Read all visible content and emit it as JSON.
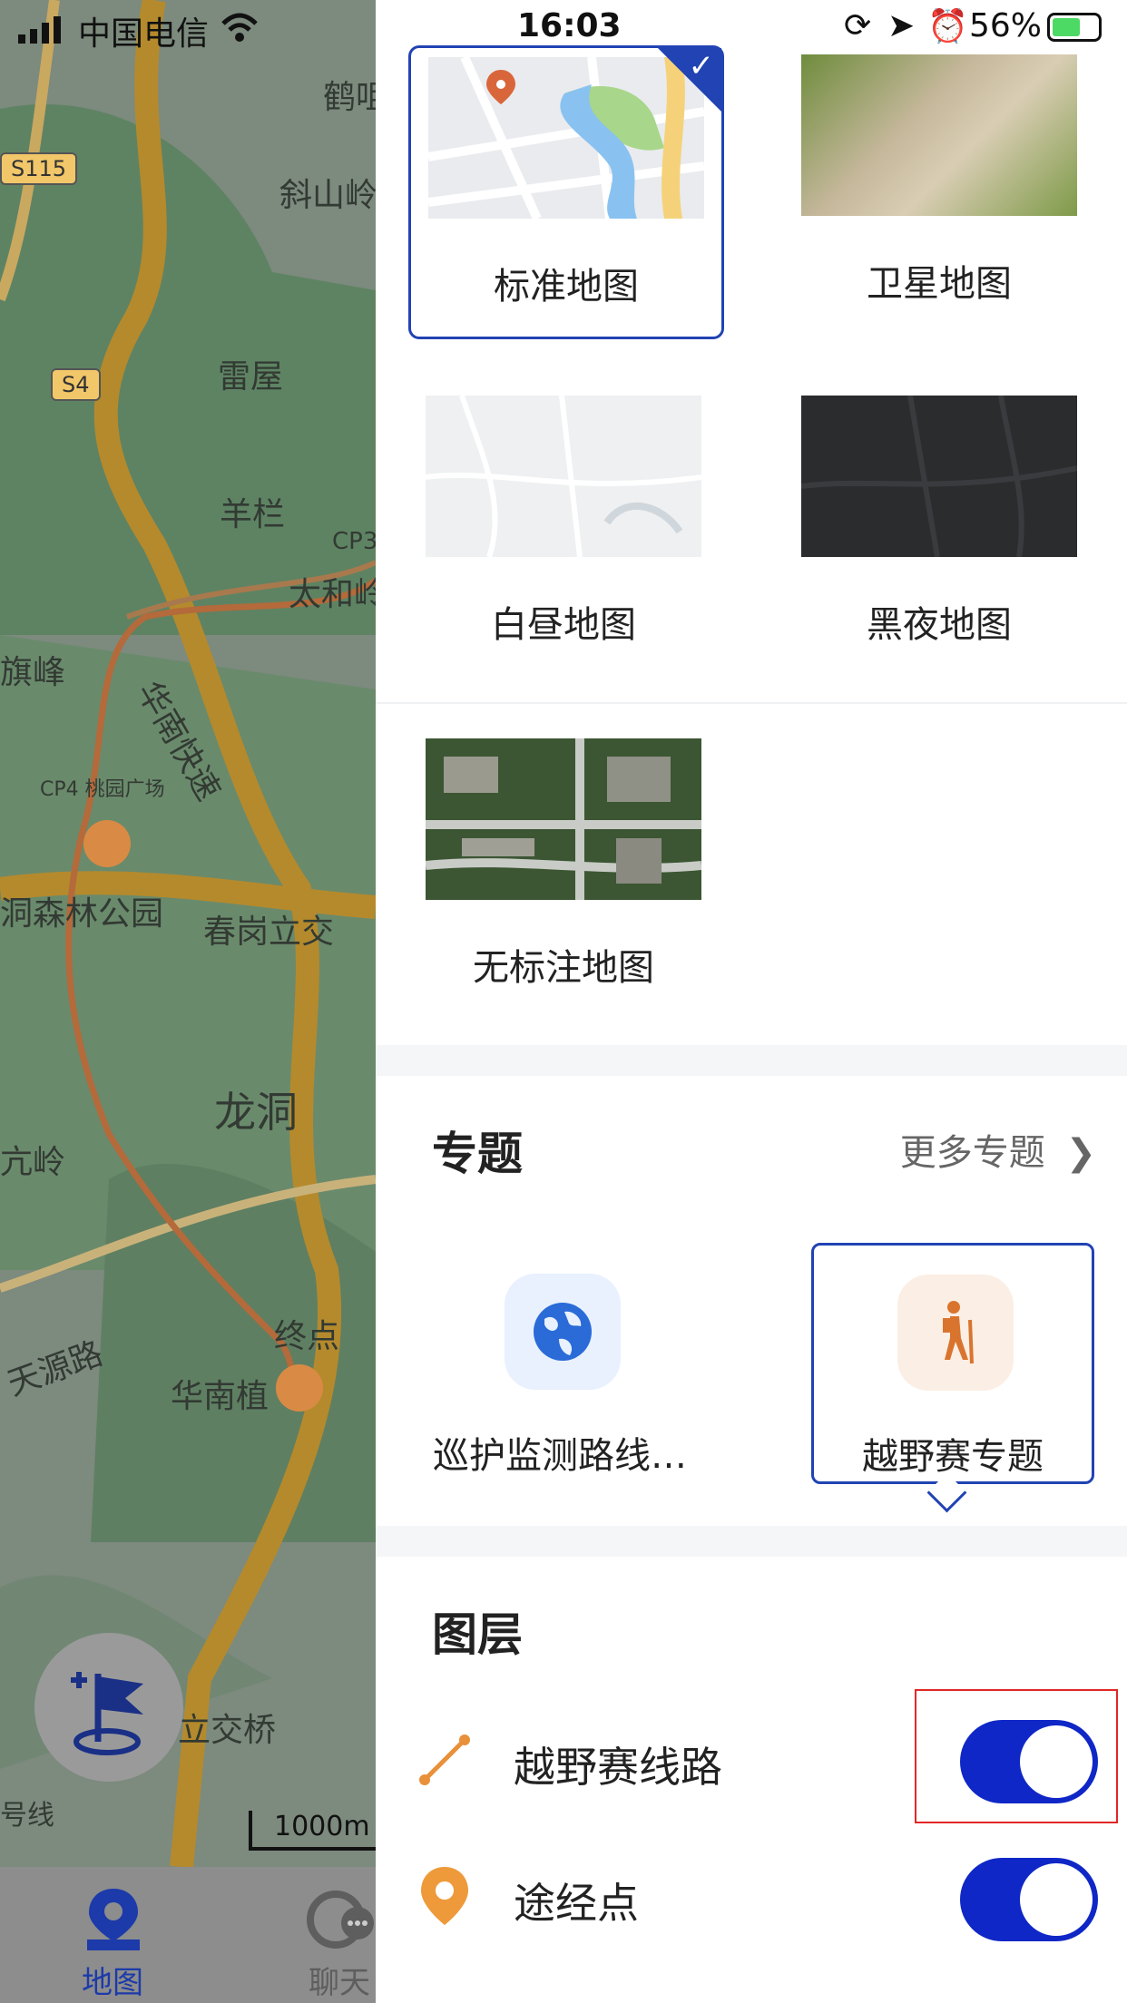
{
  "status_bar": {
    "carrier": "中国电信",
    "time": "16:03",
    "battery": "56%"
  },
  "map_background": {
    "labels": [
      "鹤咀",
      "斜山岭",
      "S115",
      "S4",
      "雷屋",
      "羊栏",
      "CP3",
      "太和岭",
      "旗峰",
      "华南快速",
      "CP4 桃园广场",
      "洞森林公园",
      "春岗立交",
      "龙洞",
      "亢岭",
      "天源路",
      "终点",
      "华南植",
      "立交桥",
      "号线"
    ],
    "scale": "1000m"
  },
  "tab_bar": {
    "map_label": "地图",
    "chat_label": "聊天"
  },
  "base_maps": [
    {
      "label": "标准地图",
      "selected": true
    },
    {
      "label": "卫星地图",
      "selected": false
    },
    {
      "label": "白昼地图",
      "selected": false
    },
    {
      "label": "黑夜地图",
      "selected": false
    },
    {
      "label": "无标注地图",
      "selected": false
    }
  ],
  "themes": {
    "title": "专题",
    "more": "更多专题",
    "items": [
      {
        "label": "巡护监测路线…",
        "icon": "globe-icon",
        "selected": false
      },
      {
        "label": "越野赛专题",
        "icon": "hiker-icon",
        "selected": true
      }
    ]
  },
  "layers": {
    "title": "图层",
    "items": [
      {
        "label": "越野赛线路",
        "icon": "route-line-icon",
        "enabled": true
      },
      {
        "label": "途经点",
        "icon": "location-pin-icon",
        "enabled": true
      }
    ]
  },
  "colors": {
    "accent": "#2143b3",
    "toggle_on": "#0f27c6",
    "route_orange": "#e8903a"
  }
}
